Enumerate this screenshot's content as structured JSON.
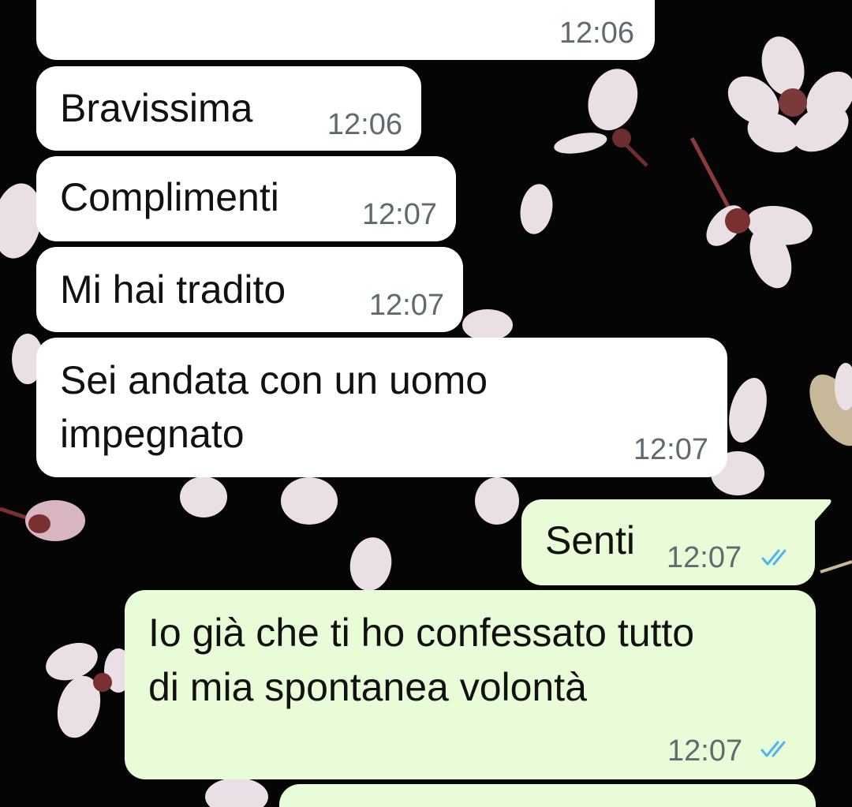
{
  "chat": {
    "messages": [
      {
        "direction": "incoming",
        "text": "",
        "time": "12:06"
      },
      {
        "direction": "incoming",
        "text": "Bravissima",
        "time": "12:06"
      },
      {
        "direction": "incoming",
        "text": "Complimenti",
        "time": "12:07"
      },
      {
        "direction": "incoming",
        "text": "Mi hai tradito",
        "time": "12:07"
      },
      {
        "direction": "incoming",
        "lines": [
          "Sei andata con un uomo",
          "impegnato"
        ],
        "time": "12:07"
      },
      {
        "direction": "outgoing",
        "text": "Senti",
        "time": "12:07",
        "status": "read"
      },
      {
        "direction": "outgoing",
        "lines": [
          "Io già che ti ho confessato tutto",
          "di mia spontanea volontà"
        ],
        "time": "12:07",
        "status": "read"
      },
      {
        "direction": "outgoing",
        "text": "",
        "time": ""
      }
    ]
  },
  "colors": {
    "wallpaper": "#050505",
    "incoming_bubble": "#ffffff",
    "outgoing_bubble": "#e8fdd7",
    "timestamp": "#5f6b6f",
    "read_ticks": "#4fb6ec"
  },
  "icons": {
    "read_receipt": "double-check-icon",
    "wallpaper": "cherry-blossom-petals"
  }
}
